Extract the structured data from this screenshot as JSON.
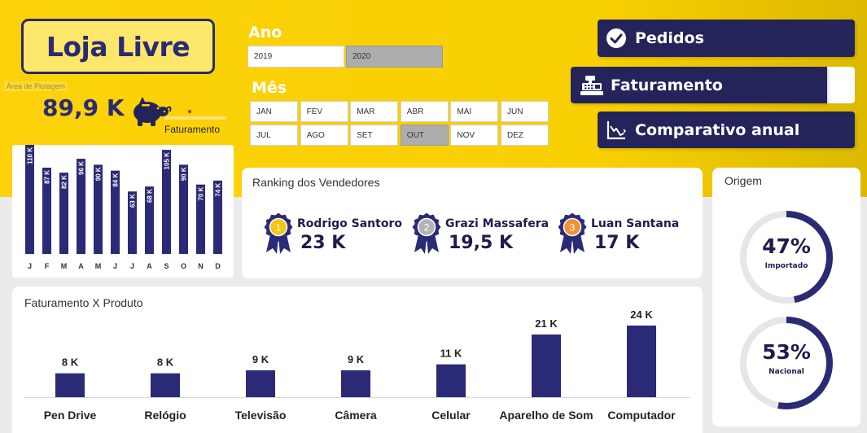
{
  "brand": {
    "name": "Loja Livre"
  },
  "area_tag": "Área de Plotagem",
  "kpi": {
    "value": "89,9 K",
    "label": "Faturamento"
  },
  "ano": {
    "title": "Ano",
    "options": [
      "2019",
      "2020"
    ],
    "selected": "2020"
  },
  "mes": {
    "title": "Mês",
    "options": [
      "JAN",
      "FEV",
      "MAR",
      "ABR",
      "MAI",
      "JUN",
      "JUL",
      "AGO",
      "SET",
      "OUT",
      "NOV",
      "DEZ"
    ],
    "selected": "OUT"
  },
  "nav": {
    "pedidos": {
      "label": "Pedidos",
      "icon": "check-circle-icon"
    },
    "faturamento": {
      "label": "Faturamento",
      "icon": "cash-register-icon"
    },
    "comparativo": {
      "label": "Comparativo anual",
      "icon": "line-chart-icon"
    }
  },
  "ranking": {
    "title": "Ranking dos Vendedores",
    "items": [
      {
        "rank": "1",
        "name": "Rodrigo Santoro",
        "value": "23 K",
        "medal_color": "#f5c518"
      },
      {
        "rank": "2",
        "name": "Grazi Massafera",
        "value": "19,5 K",
        "medal_color": "#b3b3b3"
      },
      {
        "rank": "3",
        "name": "Luan Santana",
        "value": "17 K",
        "medal_color": "#f0923a"
      }
    ]
  },
  "origem": {
    "title": "Origem",
    "items": [
      {
        "pct": "47%",
        "label": "Importado",
        "fraction": 0.47
      },
      {
        "pct": "53%",
        "label": "Nacional",
        "fraction": 0.53
      }
    ]
  },
  "colors": {
    "accent": "#2b2a76",
    "bar": "#2b2a76",
    "yellow": "#fdd20a",
    "slicer_selected": "#adadad"
  },
  "chart_data": [
    {
      "type": "bar",
      "title": "",
      "categories": [
        "J",
        "F",
        "M",
        "A",
        "M",
        "J",
        "J",
        "A",
        "S",
        "O",
        "N",
        "D"
      ],
      "values": [
        110,
        87,
        82,
        96,
        90,
        84,
        63,
        68,
        105,
        90,
        70,
        74
      ],
      "data_labels": [
        "110 K",
        "87 K",
        "82 K",
        "96 K",
        "90 K",
        "84 K",
        "63 K",
        "68 K",
        "105 K",
        "90 K",
        "70 K",
        "74 K"
      ],
      "xlabel": "",
      "ylabel": "",
      "ylim": [
        0,
        110
      ],
      "grid": false
    },
    {
      "type": "bar",
      "title": "Faturamento X Produto",
      "categories": [
        "Pen Drive",
        "Relógio",
        "Televisão",
        "Câmera",
        "Celular",
        "Aparelho de Som",
        "Computador"
      ],
      "values": [
        8,
        8,
        9,
        9,
        11,
        21,
        24
      ],
      "data_labels": [
        "8 K",
        "8 K",
        "9 K",
        "9 K",
        "11 K",
        "21 K",
        "24 K"
      ],
      "xlabel": "",
      "ylabel": "",
      "ylim": [
        0,
        24
      ],
      "grid": false
    }
  ]
}
